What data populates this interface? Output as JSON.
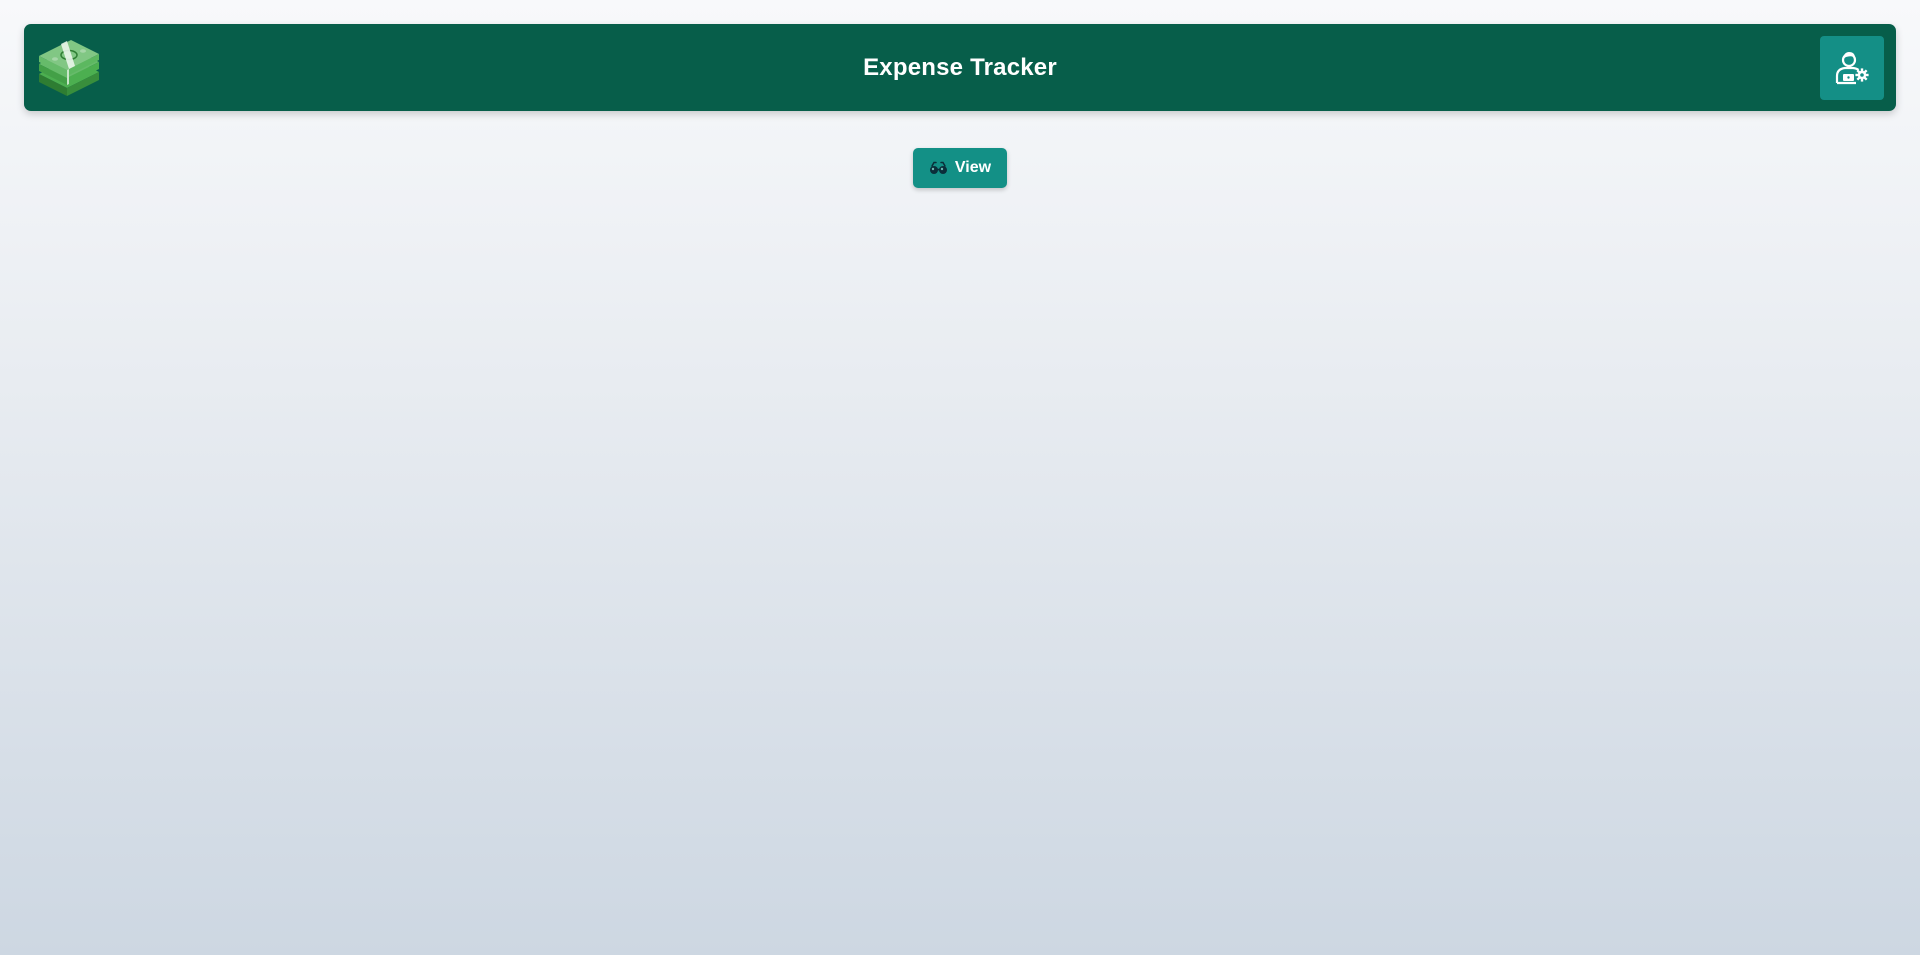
{
  "header": {
    "title": "Expense Tracker",
    "logo_icon": "money-stack-icon",
    "admin_icon": "user-settings-icon"
  },
  "actions": {
    "view_label": "View",
    "view_icon": "glasses-icon"
  },
  "colors": {
    "header_bg": "#075e4a",
    "button_bg": "#139086",
    "text": "#ffffff"
  }
}
